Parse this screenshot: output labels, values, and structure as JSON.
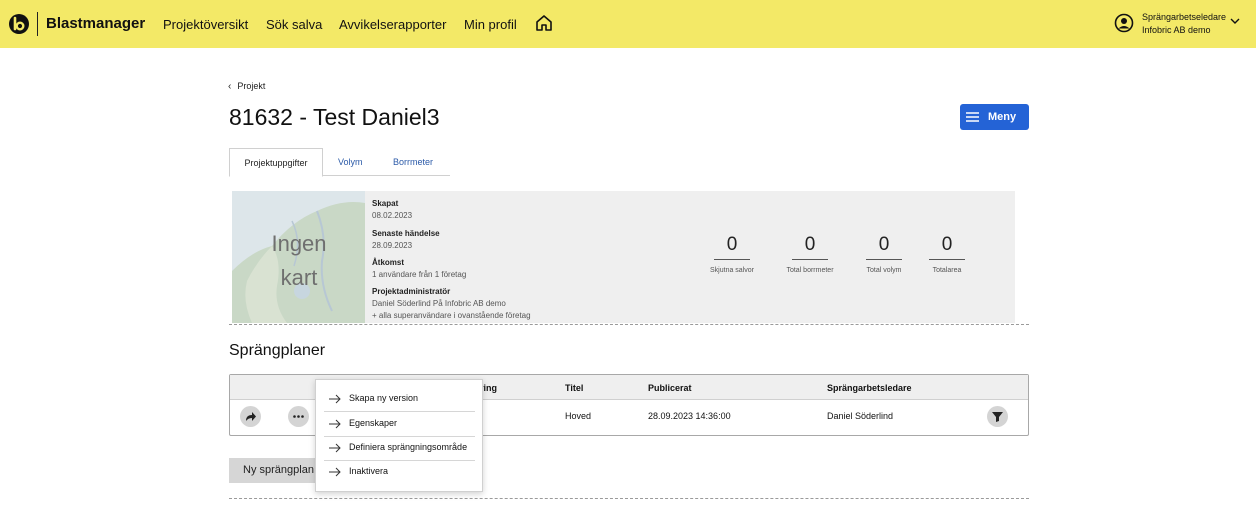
{
  "header": {
    "brand": "Blastmanager",
    "nav": [
      "Projektöversikt",
      "Sök salva",
      "Avvikelserapporter",
      "Min profil"
    ],
    "user_role": "Sprängarbetseledare",
    "user_org": "Infobric AB demo",
    "background_color": "#f3e967"
  },
  "breadcrumb": "Projekt",
  "page_title": "81632 - Test Daniel3",
  "menu_button": "Meny",
  "tabs": [
    "Projektuppgifter",
    "Volym",
    "Borrmeter"
  ],
  "info": {
    "map_placeholder": "Ingen kart",
    "created_label": "Skapat",
    "created_value": "08.02.2023",
    "last_event_label": "Senaste händelse",
    "last_event_value": "28.09.2023",
    "access_label": "Åtkomst",
    "access_value": "1 användare från 1 företag",
    "admin_label": "Projektadministratör",
    "admin_value": "Daniel Söderlind På Infobric AB demo",
    "admin_extra": "+ alla superanvändare i ovanstående företag"
  },
  "stats": [
    {
      "value": "0",
      "label": "Skjutna salvor"
    },
    {
      "value": "0",
      "label": "Total borrmeter"
    },
    {
      "value": "0",
      "label": "Total volym"
    },
    {
      "value": "0",
      "label": "Totalarea"
    }
  ],
  "section_title": "Sprängplaner",
  "table": {
    "headers": {
      "partial": "ring",
      "title": "Titel",
      "published": "Publicerat",
      "manager": "Sprängarbetsledare"
    },
    "row": {
      "title": "Hoved",
      "published": "28.09.2023 14:36:00",
      "manager": "Daniel Söderlind"
    }
  },
  "new_plan_button": "Ny sprängplan",
  "popup_menu": [
    "Skapa ny version",
    "Egenskaper",
    "Definiera sprängningsområde",
    "Inaktivera"
  ],
  "colors": {
    "accent": "#2463d6",
    "link": "#2b5aa8"
  }
}
